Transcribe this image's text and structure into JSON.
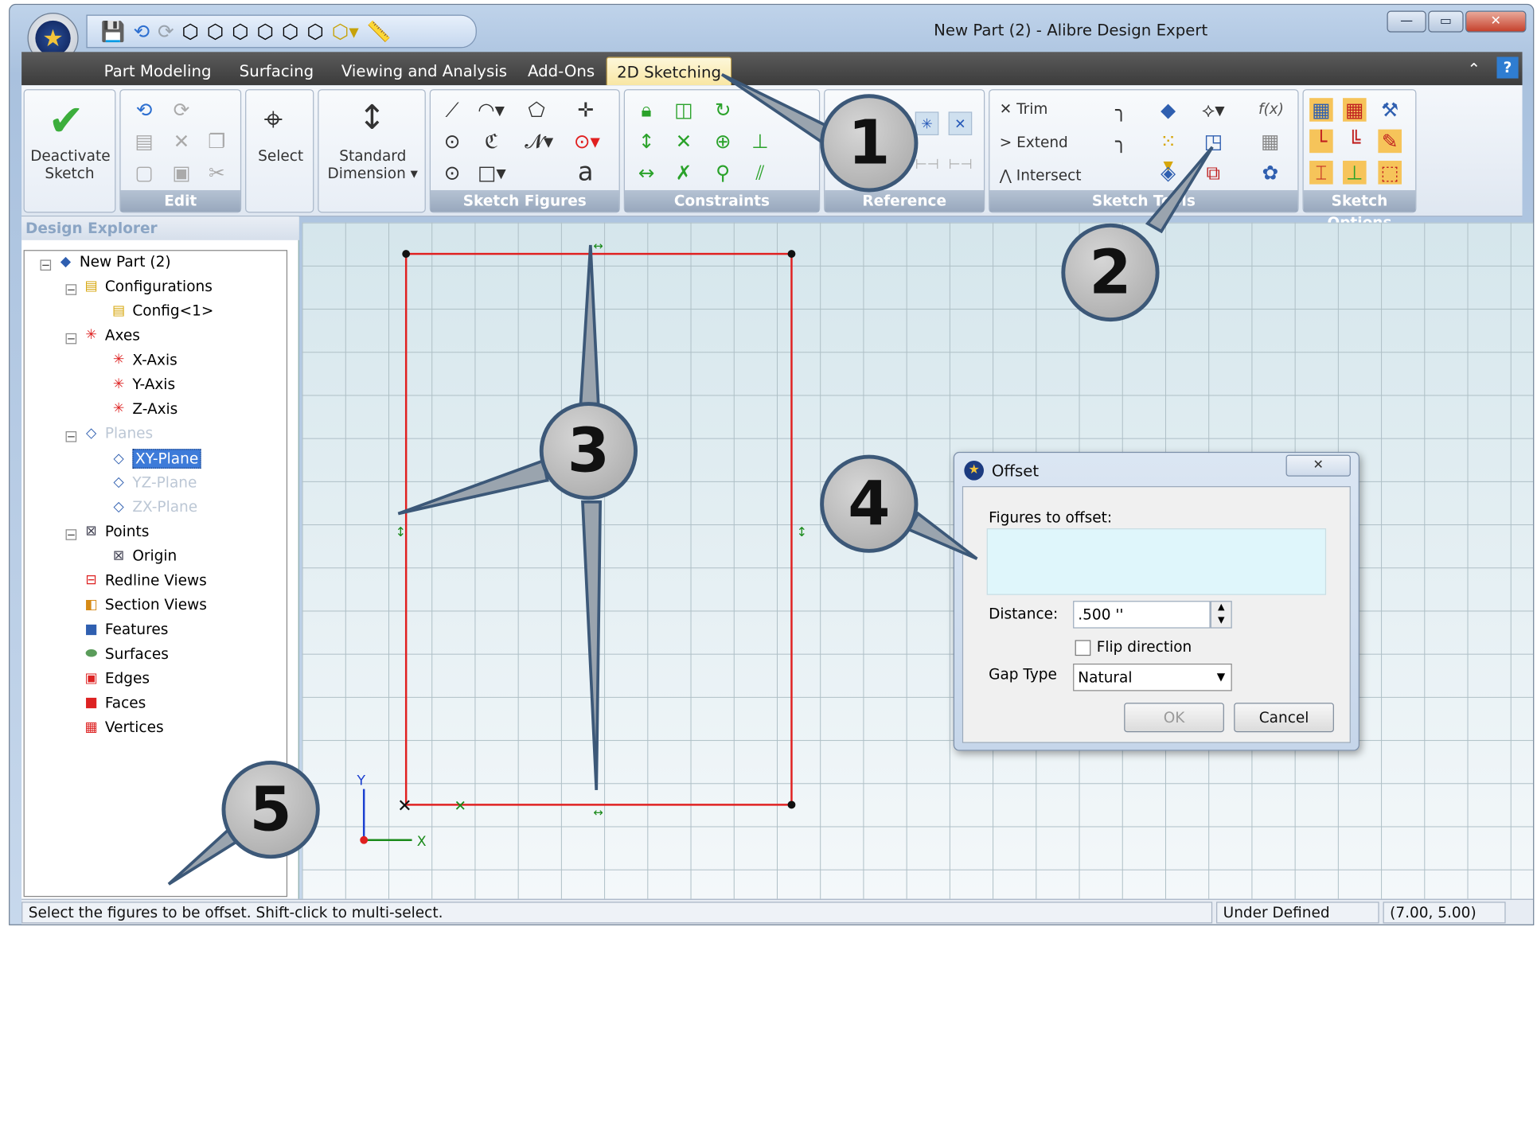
{
  "window": {
    "title": "New Part (2) - Alibre Design Expert",
    "min_label": "—",
    "max_label": "▭",
    "close_label": "✕"
  },
  "qat": {
    "icons": [
      "save-icon",
      "undo-icon",
      "redo-icon",
      "view-iso-icon",
      "view-front-icon",
      "view-right-icon",
      "view-top-icon",
      "view-left-icon",
      "view-back-icon",
      "view-dropdown-icon",
      "measure-icon"
    ]
  },
  "tabs": [
    "Part Modeling",
    "Surfacing",
    "Viewing and Analysis",
    "Add-Ons",
    "2D Sketching"
  ],
  "active_tab": "2D Sketching",
  "ribbon": {
    "deactivate_line1": "Deactivate",
    "deactivate_line2": "Sketch",
    "select": "Select",
    "std_dim_line1": "Standard",
    "std_dim_line2": "Dimension",
    "trim": "Trim",
    "extend": "Extend",
    "intersect": "Intersect",
    "fx": "f(x)",
    "groups": {
      "edit": "Edit",
      "figures": "Sketch Figures",
      "constraints": "Constraints",
      "reference": "Reference",
      "tools": "Sketch Tools",
      "options": "Sketch Options"
    }
  },
  "explorer": {
    "title": "Design Explorer",
    "root": "New Part (2)",
    "configurations": "Configurations",
    "config1": "Config<1>",
    "axes": "Axes",
    "x_axis": "X-Axis",
    "y_axis": "Y-Axis",
    "z_axis": "Z-Axis",
    "planes": "Planes",
    "xy_plane": "XY-Plane",
    "yz_plane": "YZ-Plane",
    "zx_plane": "ZX-Plane",
    "points": "Points",
    "origin": "Origin",
    "redline": "Redline Views",
    "section": "Section Views",
    "features": "Features",
    "surfaces": "Surfaces",
    "edges": "Edges",
    "faces": "Faces",
    "vertices": "Vertices"
  },
  "canvas": {
    "y_label": "Y",
    "x_label": "X"
  },
  "dialog": {
    "title": "Offset",
    "close": "✕",
    "figures_label": "Figures to offset:",
    "distance_label": "Distance:",
    "distance_value": ".500 ''",
    "flip_label": "Flip direction",
    "gap_label": "Gap Type",
    "gap_value": "Natural",
    "ok": "OK",
    "cancel": "Cancel"
  },
  "status": {
    "message": "Select the figures to be offset. Shift-click to multi-select.",
    "state": "Under Defined",
    "coords": "(7.00, 5.00)"
  },
  "callouts": [
    "1",
    "2",
    "3",
    "4",
    "5"
  ],
  "colors": {
    "sketch_line": "#e02020",
    "callout_border": "#3c5878",
    "active_tab": "#f8e6a3"
  }
}
